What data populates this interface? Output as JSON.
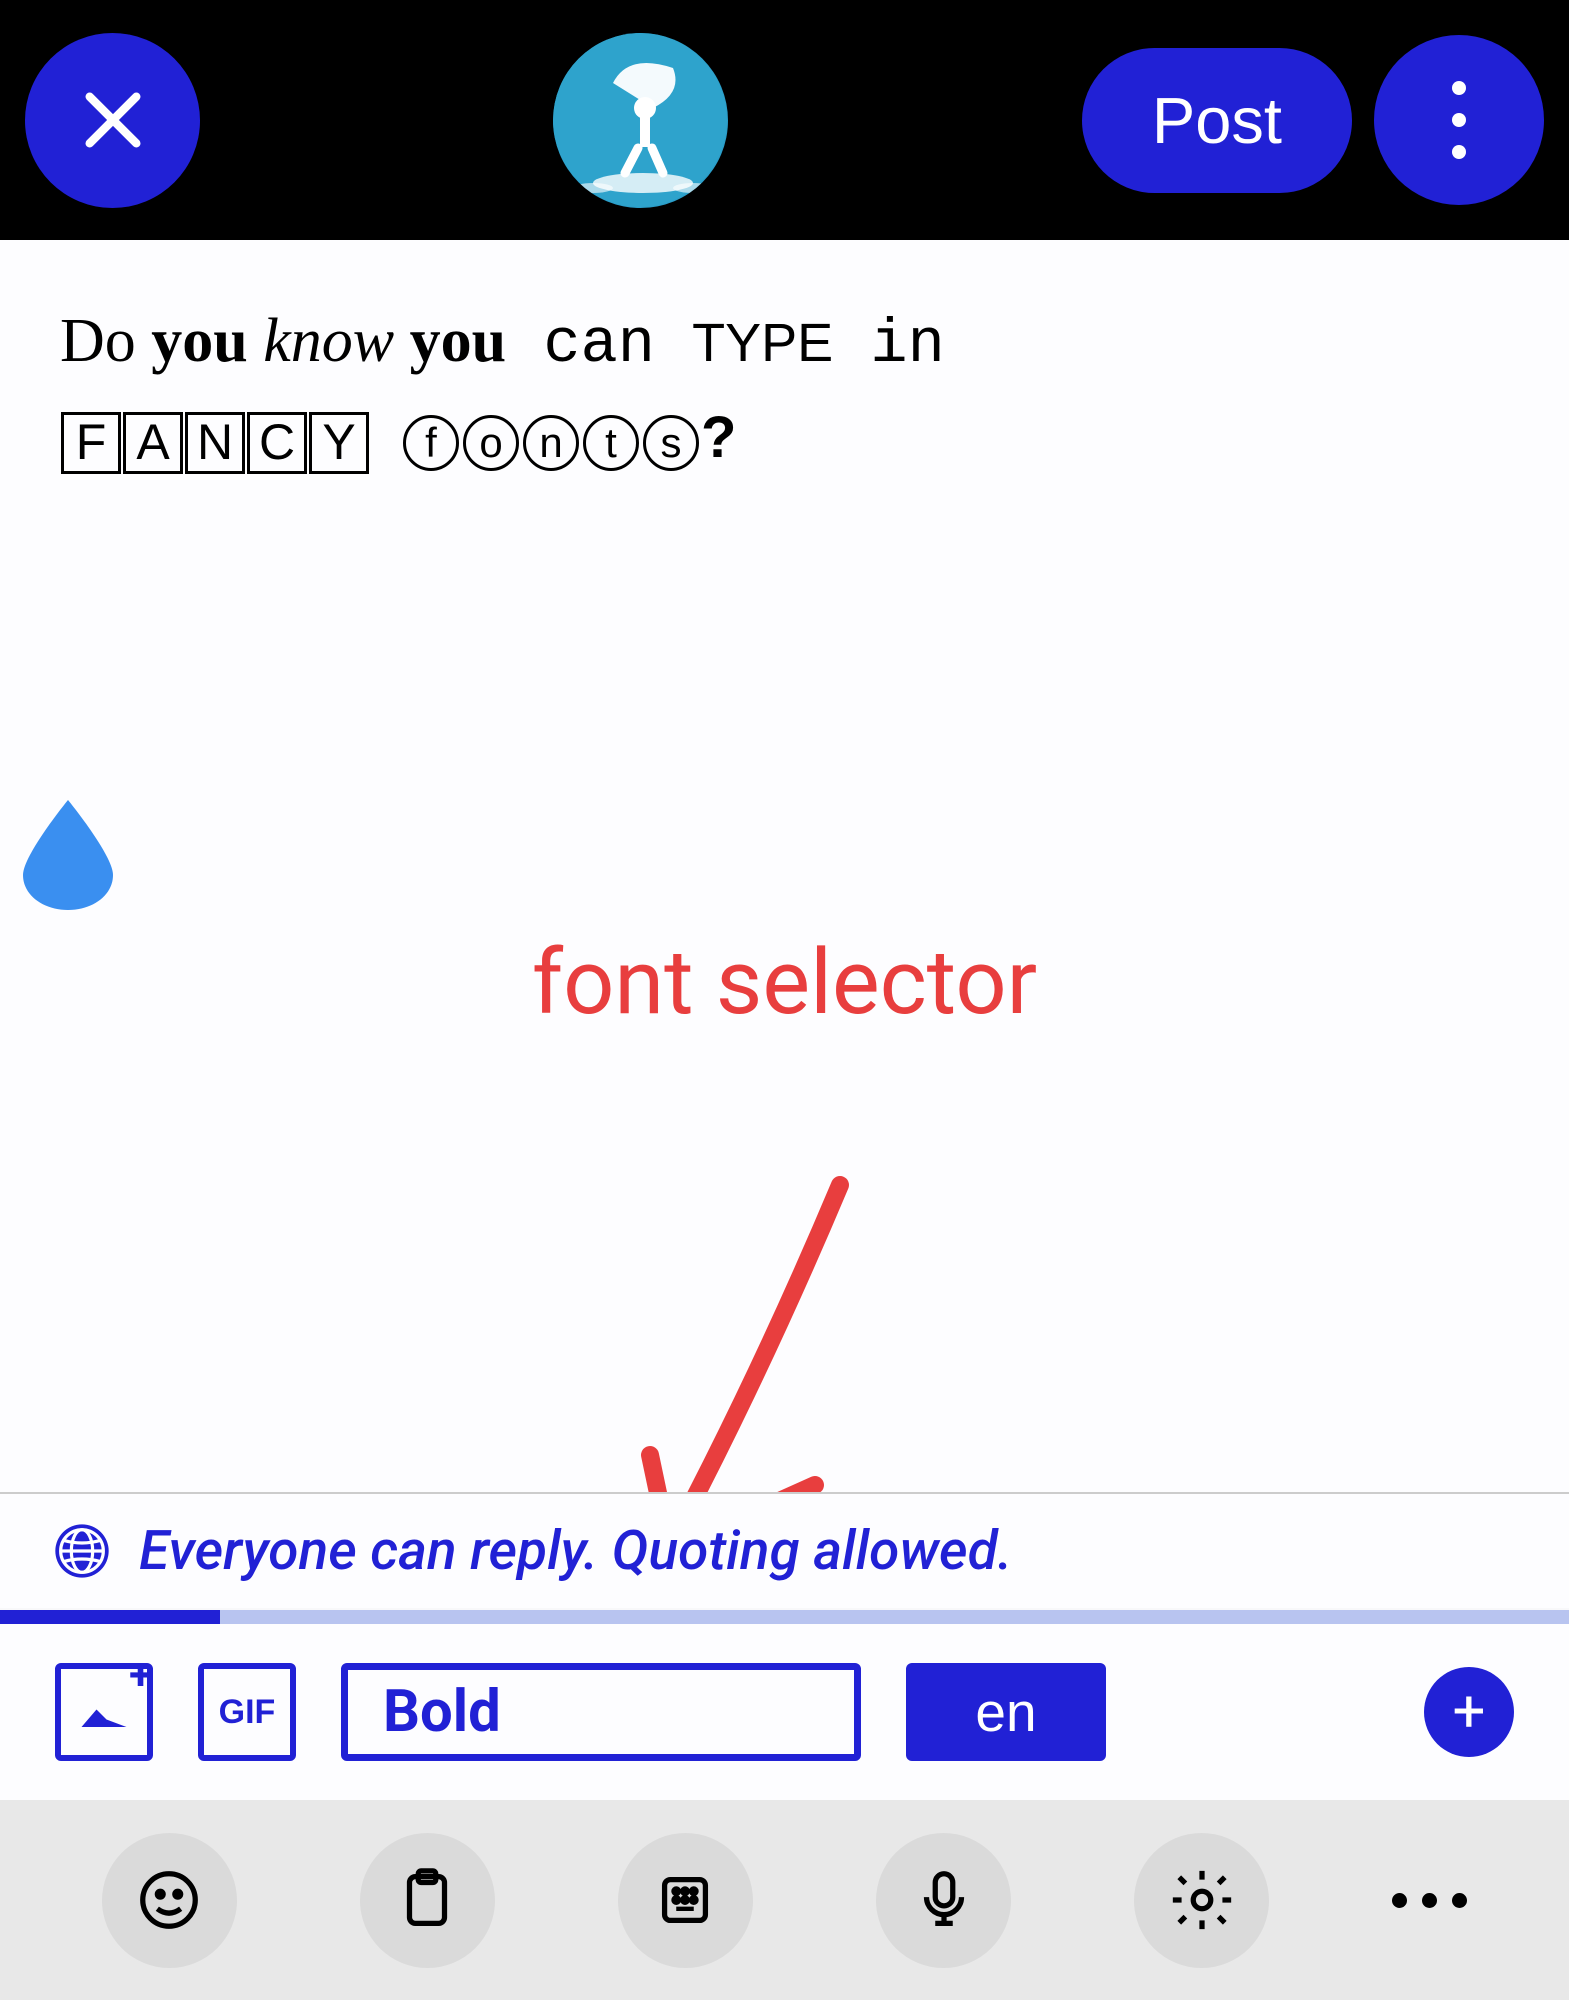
{
  "header": {
    "post_label": "Post"
  },
  "compose": {
    "text_segments": {
      "do": "Do ",
      "you1": "you",
      "know": " know ",
      "you2": "you",
      "can": " can ",
      "type": "TYPE",
      "in": " in",
      "fancy_letters": [
        "F",
        "A",
        "N",
        "C",
        "Y"
      ],
      "fonts_letters": [
        "f",
        "o",
        "n",
        "t",
        "s"
      ],
      "question": "?"
    }
  },
  "annotation": {
    "label": "font selector"
  },
  "reply_settings": {
    "text": "Everyone can reply. Quoting allowed."
  },
  "toolbar": {
    "gif_label": "GIF",
    "font_style_label": "Bold",
    "language_label": "en"
  }
}
